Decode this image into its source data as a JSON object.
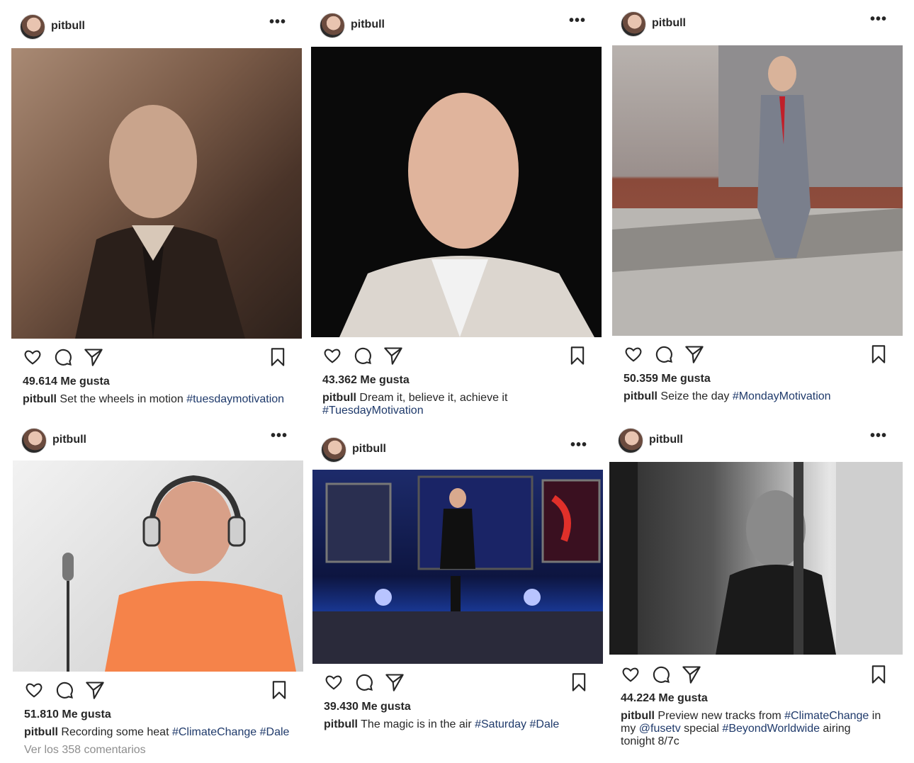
{
  "posts": [
    {
      "username": "pitbull",
      "more_label": "•••",
      "photo_desc": "sepia",
      "likes": "49.614 Me gusta",
      "caption_user": "pitbull",
      "caption_text": " Set the wheels in motion ",
      "caption_tags": [
        "#tuesdaymotivation"
      ]
    },
    {
      "username": "pitbull",
      "more_label": "•••",
      "photo_desc": "portrait",
      "likes": "43.362 Me gusta",
      "caption_user": "pitbull",
      "caption_text": " Dream it, believe it, achieve it ",
      "caption_tags": [
        "#TuesdayMotivation"
      ]
    },
    {
      "username": "pitbull",
      "more_label": "•••",
      "photo_desc": "rooftop",
      "likes": "50.359 Me gusta",
      "caption_user": "pitbull",
      "caption_text": " Seize the day ",
      "caption_tags": [
        "#MondayMotivation"
      ]
    },
    {
      "username": "pitbull",
      "more_label": "•••",
      "photo_desc": "studio",
      "likes": "51.810 Me gusta",
      "caption_user": "pitbull",
      "caption_text": " Recording some heat ",
      "caption_tags": [
        "#ClimateChange",
        "#Dale"
      ],
      "comments_link": "Ver los 358 comentarios"
    },
    {
      "username": "pitbull",
      "more_label": "•••",
      "photo_desc": "concert",
      "likes": "39.430 Me gusta",
      "caption_user": "pitbull",
      "caption_text": " The magic is in the air ",
      "caption_tags": [
        "#Saturday",
        "#Dale"
      ]
    },
    {
      "username": "pitbull",
      "more_label": "•••",
      "photo_desc": "bw-window",
      "likes": "44.224 Me gusta",
      "caption_user": "pitbull",
      "caption_parts": [
        {
          "t": "text",
          "v": " Preview new tracks from "
        },
        {
          "t": "tag",
          "v": "#ClimateChange"
        },
        {
          "t": "text",
          "v": " in my "
        },
        {
          "t": "tag",
          "v": "@fusetv"
        },
        {
          "t": "text",
          "v": " special  "
        },
        {
          "t": "tag",
          "v": "#BeyondWorldwide"
        },
        {
          "t": "text",
          "v": " airing tonight 8/7c"
        }
      ]
    }
  ],
  "icons": {
    "like": "heart-icon",
    "comment": "comment-icon",
    "share": "share-icon",
    "save": "bookmark-icon"
  },
  "colors": {
    "text": "#262626",
    "hashtag": "#1f3a6b",
    "muted": "#8e8e8e"
  }
}
